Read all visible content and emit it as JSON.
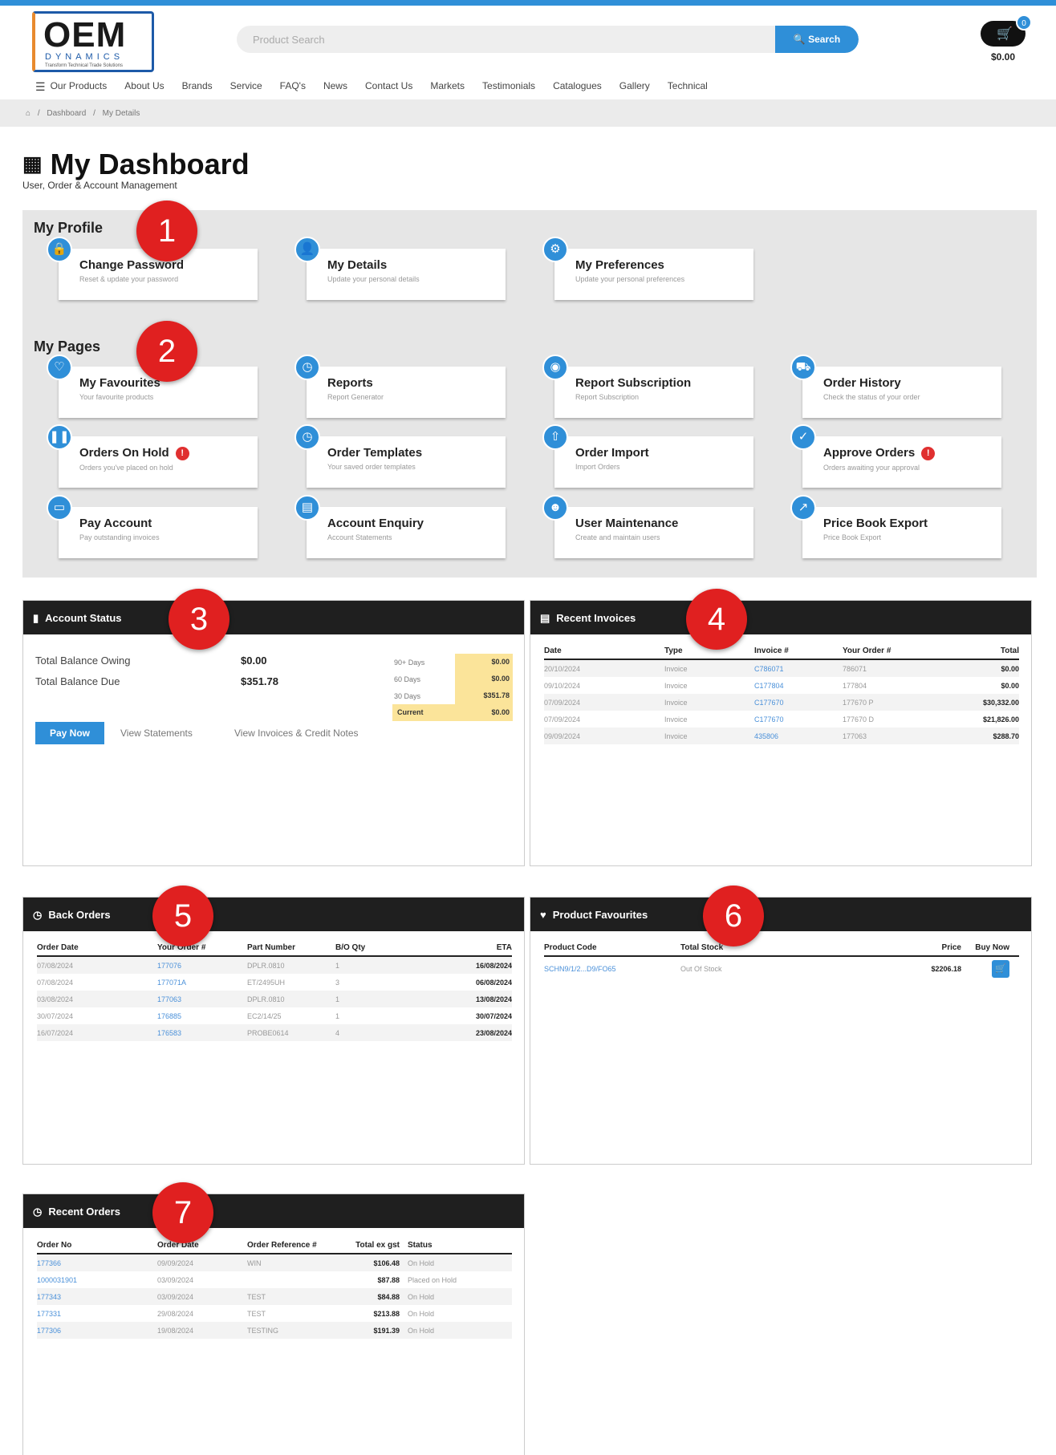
{
  "header": {
    "logo_main": "OEM",
    "logo_sub": "DYNAMICS",
    "logo_tag": "Transform Technical Trade Solutions",
    "search_placeholder": "Product Search",
    "search_button": "Search",
    "cart_count": "0",
    "cart_total": "$0.00"
  },
  "nav": {
    "items": [
      "Our Products",
      "About Us",
      "Brands",
      "Service",
      "FAQ's",
      "News",
      "Contact Us",
      "Markets",
      "Testimonials",
      "Catalogues",
      "Gallery",
      "Technical"
    ]
  },
  "breadcrumb": {
    "home_icon": "home-icon",
    "items": [
      "Dashboard",
      "My Details"
    ]
  },
  "page": {
    "title": "My Dashboard",
    "subtitle": "User, Order & Account Management"
  },
  "profile": {
    "heading": "My Profile",
    "cards": [
      {
        "title": "Change Password",
        "desc": "Reset & update your password",
        "icon": "lock-icon"
      },
      {
        "title": "My Details",
        "desc": "Update your personal details",
        "icon": "user-icon"
      },
      {
        "title": "My Preferences",
        "desc": "Update your personal preferences",
        "icon": "gear-icon"
      }
    ]
  },
  "pages": {
    "heading": "My Pages",
    "cards": [
      {
        "title": "My Favourites",
        "desc": "Your favourite products",
        "icon": "heart-icon"
      },
      {
        "title": "Reports",
        "desc": "Report Generator",
        "icon": "chart-icon"
      },
      {
        "title": "Report Subscription",
        "desc": "Report Subscription",
        "icon": "subscription-icon"
      },
      {
        "title": "Order History",
        "desc": "Check the status of your order",
        "icon": "truck-icon"
      },
      {
        "title": "Orders On Hold",
        "desc": "Orders you've placed on hold",
        "icon": "pause-icon",
        "alert": "!"
      },
      {
        "title": "Order Templates",
        "desc": "Your saved order templates",
        "icon": "template-icon"
      },
      {
        "title": "Order Import",
        "desc": "Import Orders",
        "icon": "upload-icon"
      },
      {
        "title": "Approve Orders",
        "desc": "Orders awaiting your approval",
        "icon": "check-icon",
        "alert": "!"
      },
      {
        "title": "Pay Account",
        "desc": "Pay outstanding invoices",
        "icon": "credit-card-icon"
      },
      {
        "title": "Account Enquiry",
        "desc": "Account Statements",
        "icon": "briefcase-icon"
      },
      {
        "title": "User Maintenance",
        "desc": "Create and maintain users",
        "icon": "users-icon"
      },
      {
        "title": "Price Book Export",
        "desc": "Price Book Export",
        "icon": "export-icon"
      }
    ]
  },
  "markers": [
    "1",
    "2",
    "3",
    "4",
    "5",
    "6",
    "7"
  ],
  "account_status": {
    "title": "Account Status",
    "owing_label": "Total Balance Owing",
    "owing_value": "$0.00",
    "due_label": "Total Balance Due",
    "due_value": "$351.78",
    "aging": [
      {
        "label": "90+ Days",
        "value": "$0.00"
      },
      {
        "label": "60 Days",
        "value": "$0.00"
      },
      {
        "label": "30 Days",
        "value": "$351.78"
      },
      {
        "label": "Current",
        "value": "$0.00"
      }
    ],
    "pay_now": "Pay Now",
    "view_statements": "View Statements",
    "view_invoices": "View Invoices & Credit Notes"
  },
  "recent_invoices": {
    "title": "Recent Invoices",
    "headers": [
      "Date",
      "Type",
      "Invoice #",
      "Your Order #",
      "Total"
    ],
    "rows": [
      [
        "20/10/2024",
        "Invoice",
        "C786071",
        "786071",
        "$0.00"
      ],
      [
        "09/10/2024",
        "Invoice",
        "C177804",
        "177804",
        "$0.00"
      ],
      [
        "07/09/2024",
        "Invoice",
        "C177670",
        "177670 P",
        "$30,332.00"
      ],
      [
        "07/09/2024",
        "Invoice",
        "C177670",
        "177670 D",
        "$21,826.00"
      ],
      [
        "09/09/2024",
        "Invoice",
        "435806",
        "177063",
        "$288.70"
      ]
    ]
  },
  "back_orders": {
    "title": "Back Orders",
    "headers": [
      "Order Date",
      "Your Order #",
      "Part Number",
      "B/O Qty",
      "ETA"
    ],
    "rows": [
      [
        "07/08/2024",
        "177076",
        "DPLR.0810",
        "1",
        "16/08/2024"
      ],
      [
        "07/08/2024",
        "177071A",
        "ET/2495UH",
        "3",
        "06/08/2024"
      ],
      [
        "03/08/2024",
        "177063",
        "DPLR.0810",
        "1",
        "13/08/2024"
      ],
      [
        "30/07/2024",
        "176885",
        "EC2/14/25",
        "1",
        "30/07/2024"
      ],
      [
        "16/07/2024",
        "176583",
        "PROBE0614",
        "4",
        "23/08/2024"
      ]
    ]
  },
  "product_favourites": {
    "title": "Product Favourites",
    "headers": [
      "Product Code",
      "Total Stock",
      "Price",
      "Buy Now"
    ],
    "rows": [
      [
        "SCHN9/1/2...D9/FO65",
        "Out Of Stock",
        "$2206.18",
        "cart-icon"
      ]
    ]
  },
  "recent_orders": {
    "title": "Recent Orders",
    "headers": [
      "Order No",
      "Order Date",
      "Order Reference #",
      "Total ex gst",
      "Status"
    ],
    "rows": [
      [
        "177366",
        "09/09/2024",
        "WIN",
        "$106.48",
        "On Hold"
      ],
      [
        "1000031901",
        "03/09/2024",
        "",
        "$87.88",
        "Placed on Hold"
      ],
      [
        "177343",
        "03/09/2024",
        "TEST",
        "$84.88",
        "On Hold"
      ],
      [
        "177331",
        "29/08/2024",
        "TEST",
        "$213.88",
        "On Hold"
      ],
      [
        "177306",
        "19/08/2024",
        "TESTING",
        "$191.39",
        "On Hold"
      ]
    ]
  },
  "colors": {
    "accent": "#2f8fd8",
    "dark_header": "#1f1f1f",
    "marker": "#e02020",
    "aging_highlight": "#fbe49a",
    "panel": "#e6e6e6"
  }
}
